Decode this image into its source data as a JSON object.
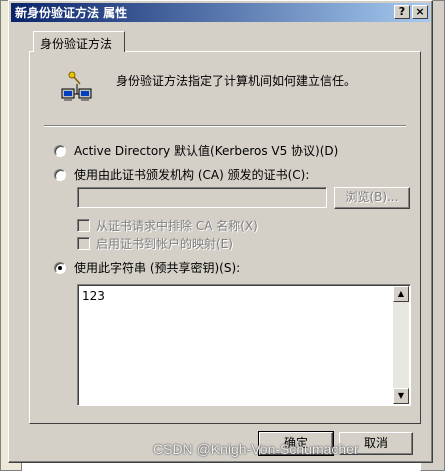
{
  "window": {
    "title": "新身份验证方法 属性",
    "help_button": "?",
    "close_button": "×"
  },
  "tabs": [
    {
      "label": "身份验证方法"
    }
  ],
  "info": {
    "icon": "network-auth-icon",
    "text": "身份验证方法指定了计算机间如何建立信任。"
  },
  "options": {
    "kerberos_label": "Active Directory 默认值(Kerberos V5 协议)(D)",
    "certificate_label": "使用由此证书颁发机构 (CA) 颁发的证书(C):",
    "certificate_value": "",
    "browse_label": "浏览(B)...",
    "exclude_ca_label": "从证书请求中排除 CA 名称(X)",
    "map_cert_label": "启用证书到帐户的映射(E)",
    "psk_label": "使用此字符串 (预共享密钥)(S):",
    "psk_value": "123",
    "selected": "psk"
  },
  "buttons": {
    "ok": "确定",
    "cancel": "取消"
  },
  "watermark": "CSDN @Knigh-Von-Schumacher",
  "colors": {
    "titlebar_start": "#0a246a",
    "titlebar_end": "#a6caf0",
    "face": "#d4d0c8"
  }
}
